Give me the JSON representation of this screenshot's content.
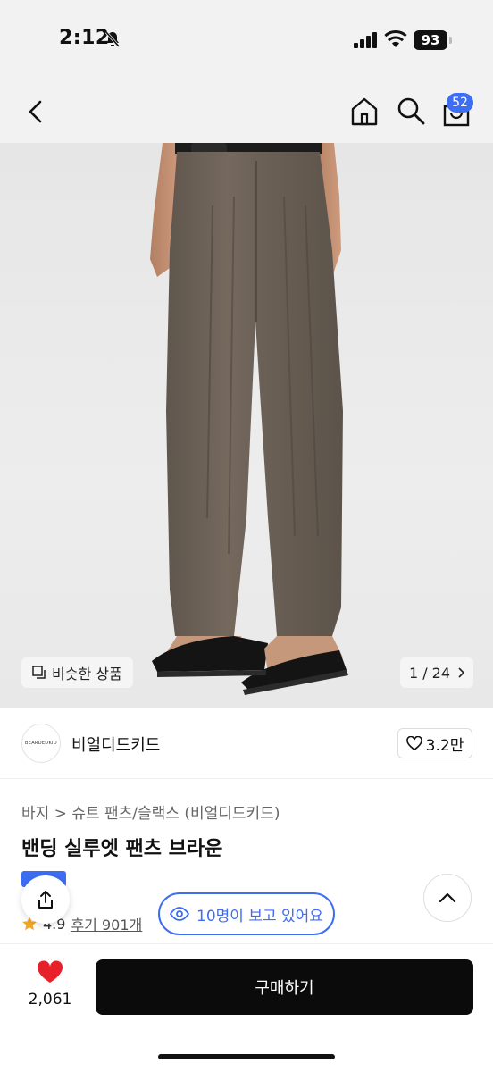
{
  "status": {
    "time": "2:12",
    "battery": "93"
  },
  "nav": {
    "cart_count": "52"
  },
  "hero": {
    "similar_label": "비슷한 상품",
    "page_indicator": "1 / 24"
  },
  "brand": {
    "name": "비얼디드키드",
    "logo_text": "BEARDEDKID",
    "likes": "3.2만"
  },
  "product": {
    "breadcrumb": "바지 > 슈트 팬츠/슬랙스 (비얼디드키드)",
    "title": "밴딩 실루엣 팬츠 브라운",
    "rating": "4.9",
    "reviews": "후기 901개",
    "viewers": "10명이 보고 있어요"
  },
  "bottom": {
    "wish_count": "2,061",
    "buy_label": "구매하기"
  },
  "colors": {
    "accent": "#3d6df2",
    "heart": "#e8202a",
    "pants": "#6e6459"
  },
  "icons": [
    "bell-slash-icon",
    "signal-icon",
    "wifi-icon",
    "back-icon",
    "home-icon",
    "search-icon",
    "bag-icon",
    "similar-icon",
    "chevron-right-icon",
    "heart-outline-icon",
    "share-icon",
    "star-icon",
    "eye-icon",
    "chevron-up-icon",
    "heart-icon"
  ]
}
